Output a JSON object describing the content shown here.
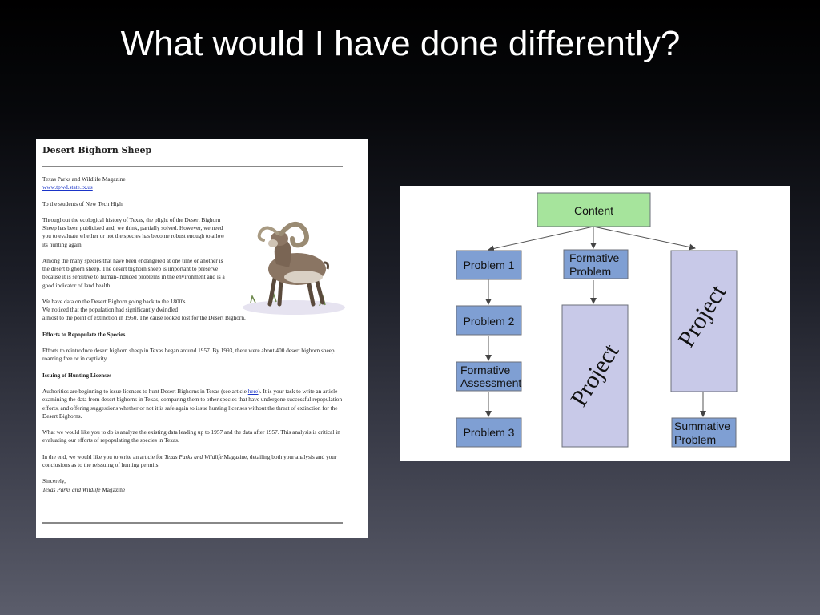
{
  "slide": {
    "title": "What would I have done differently?"
  },
  "document": {
    "heading": "Desert Bighorn Sheep",
    "source": "Texas Parks and Wildlife Magazine",
    "url": "www.tpwd.state.tx.us",
    "greeting": "To the students of New Tech High",
    "para1": "Throughout the ecological history of Texas, the plight of the Desert Bighorn Sheep has been publicized and, we think, partially solved. However, we need you to evaluate whether or not the species has become robust enough to allow its hunting again.",
    "para2": "Among the many species that have been endangered at one time or another is the desert bighorn sheep. The desert bighorn sheep is important to preserve because it is sensitive to human-induced problems in the environment and is a good indicator of land health.",
    "para3_a": "We have data on the Desert Bighorn going back to the 1800's.",
    "para3_b": "We noticed that the population had significantly dwindled",
    "para3_c": "almost to the point of extinction in 1950. The cause looked lost for the Desert Bighorn.",
    "section1_title": "Efforts to Repopulate the Species",
    "section1_text": "Efforts to reintroduce desert bighorn sheep in Texas began around 1957. By 1993, there were about 400 desert bighorn sheep roaming free or in captivity.",
    "section2_title": "Issuing of Hunting Licenses",
    "section2_text_a": "Authorities are beginning to issue licenses to hunt Desert Bighorns in Texas (see article ",
    "section2_link": "here",
    "section2_text_b": "). It is your task to write an article examining the data from desert bighorns in Texas, comparing them to other species that have undergone successful repopulation efforts, and offering suggestions whether or not it is safe again to issue hunting licenses without the threat of extinction for the Desert Bighorns.",
    "para4": "What we would like you to do is analyze the existing data leading up to 1957 and the data after 1957. This analysis is critical in evaluating our efforts of repopulating the species in Texas.",
    "para5_a": "In the end, we would like you to write an article for ",
    "para5_italic": "Texas Parks and Wildlife",
    "para5_b": " Magazine, detailing both your analysis and your conclusions as to the reissuing of hunting permits.",
    "closing": "Sincerely,",
    "signature_italic": "Texas Parks and Wildlife",
    "signature_rest": " Magazine"
  },
  "diagram": {
    "colors": {
      "content_fill": "#a6e49c",
      "blue_fill": "#7f9fd3",
      "lavender_fill": "#c8c9e8",
      "stroke": "#6b6f7a"
    },
    "content": "Content",
    "problem1": "Problem 1",
    "problem2": "Problem 2",
    "formative_assessment_1": "Formative",
    "formative_assessment_2": "Assessment",
    "problem3": "Problem 3",
    "formative_problem_1": "Formative",
    "formative_problem_2": "Problem",
    "project_middle": "Project",
    "project_right": "Project",
    "summative_problem_1": "Summative",
    "summative_problem_2": "Problem"
  }
}
